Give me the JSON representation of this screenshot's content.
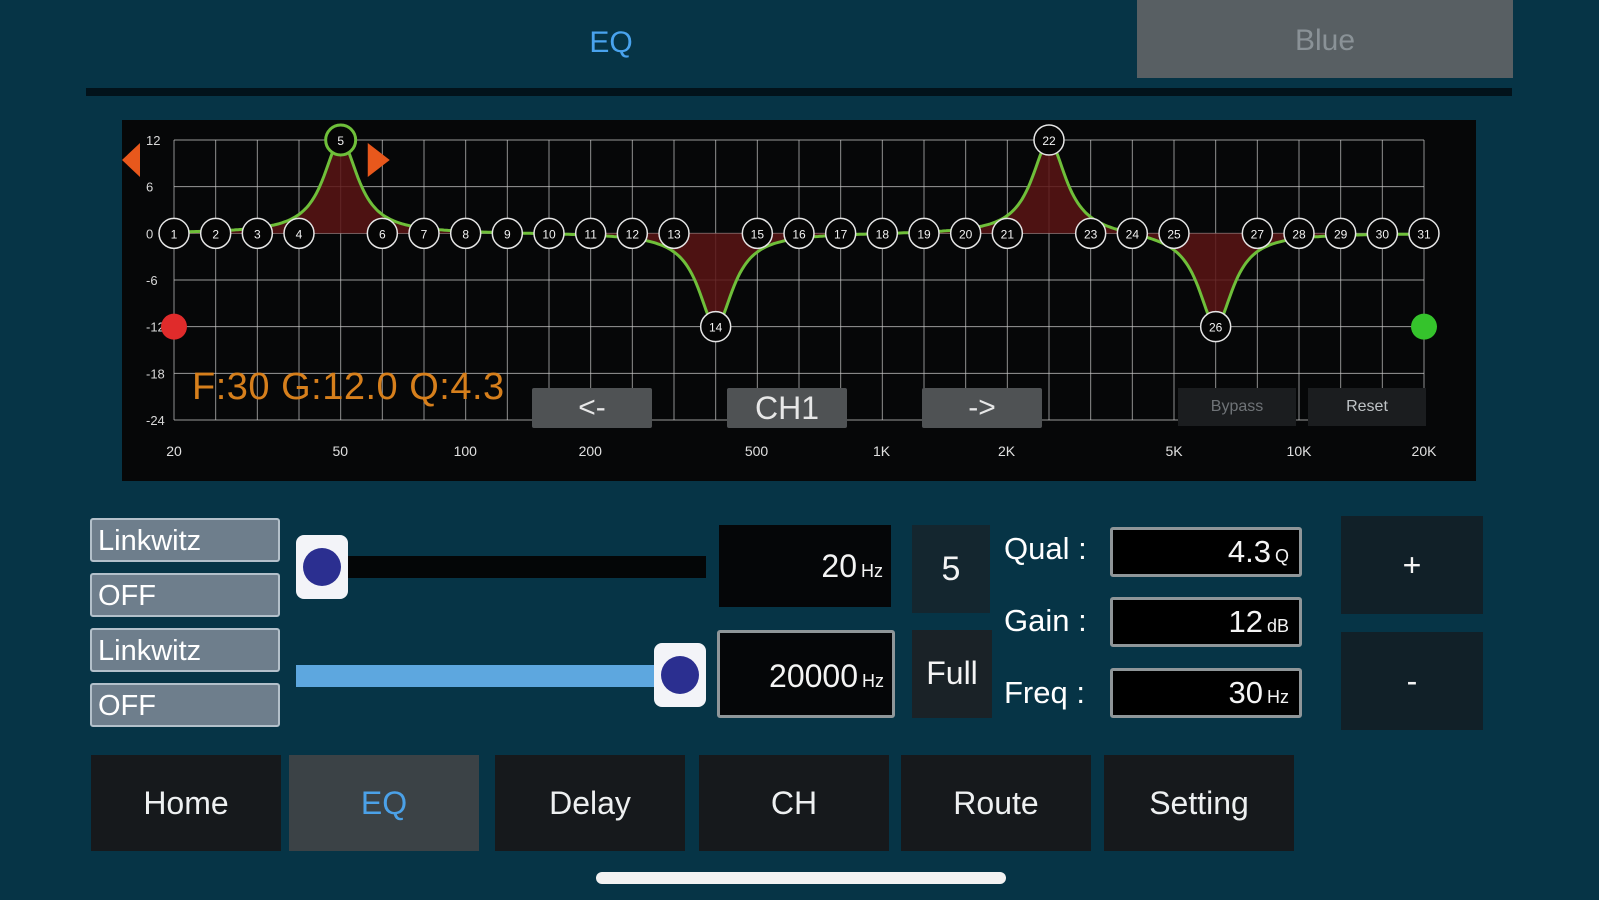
{
  "header": {
    "title": "EQ",
    "device_tab": "Blue"
  },
  "graph": {
    "y_labels": [
      "12",
      "6",
      "0",
      "-6",
      "-12",
      "-18",
      "-24"
    ],
    "x_labels": [
      "20",
      "50",
      "100",
      "200",
      "500",
      "1K",
      "2K",
      "5K",
      "10K",
      "20K"
    ],
    "band_numbers": [
      "1",
      "2",
      "3",
      "4",
      "5",
      "6",
      "7",
      "8",
      "9",
      "10",
      "11",
      "12",
      "13",
      "14",
      "15",
      "16",
      "17",
      "18",
      "19",
      "20",
      "21",
      "22",
      "23",
      "24",
      "25",
      "26",
      "27",
      "28",
      "29",
      "30",
      "31"
    ],
    "boosted_bands": [
      {
        "band": "5",
        "gain_db": 12
      },
      {
        "band": "22",
        "gain_db": 12
      },
      {
        "band": "14",
        "gain_db": -12
      },
      {
        "band": "26",
        "gain_db": -12
      }
    ],
    "readout": "F:30  G:12.0  Q:4.3",
    "prev_label": "<-",
    "channel_label": "CH1",
    "next_label": "->",
    "bypass_label": "Bypass",
    "reset_label": "Reset",
    "curve_color": "#6fbf3a",
    "fill_color": "#5a1414",
    "low_marker_color": "#e02b2b",
    "high_marker_color": "#35c32c",
    "range_marker_color": "#e8581c"
  },
  "crossover": {
    "hp_type": "Linkwitz",
    "hp_slope": "OFF",
    "lp_type": "Linkwitz",
    "lp_slope": "OFF",
    "hp_freq": "20",
    "lp_freq": "20000",
    "unit": "Hz",
    "hp_slider_position": 0.0,
    "lp_slider_position": 1.0,
    "band_display": "5",
    "full_label": "Full"
  },
  "params": {
    "qual_label": "Qual :",
    "qual_value": "4.3",
    "qual_unit": "Q",
    "gain_label": "Gain :",
    "gain_value": "12",
    "gain_unit": "dB",
    "freq_label": "Freq :",
    "freq_value": "30",
    "freq_unit": "Hz",
    "plus_label": "+",
    "minus_label": "-"
  },
  "nav": {
    "tabs": [
      "Home",
      "EQ",
      "Delay",
      "CH",
      "Route",
      "Setting"
    ],
    "active": "EQ",
    "active_color": "#4ba1e8"
  }
}
